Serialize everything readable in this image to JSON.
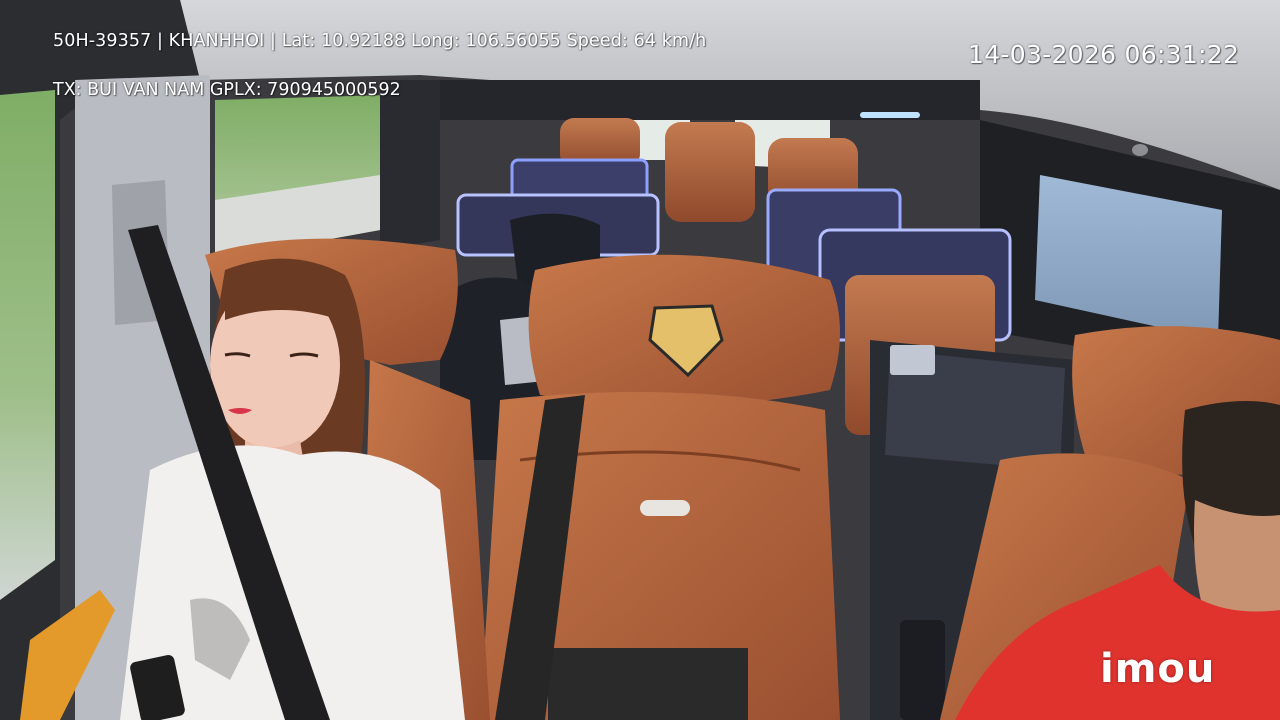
{
  "overlay": {
    "info_line": "50H-39357 | KHANHHOI | Lat: 10.92188 Long: 106.56055 Speed: 64 km/h",
    "driver_line": "TX: BUI VAN NAM GPLX: 790945000592",
    "datetime": "14-03-2026 06:31:22"
  },
  "watermark": "imou",
  "colors": {
    "seat_leather": "#b8693a",
    "seat_dark": "#2a2a2a",
    "ceiling": "#c9cacd",
    "shirt_red": "#e0332e",
    "shirt_white": "#f2f0ee"
  }
}
